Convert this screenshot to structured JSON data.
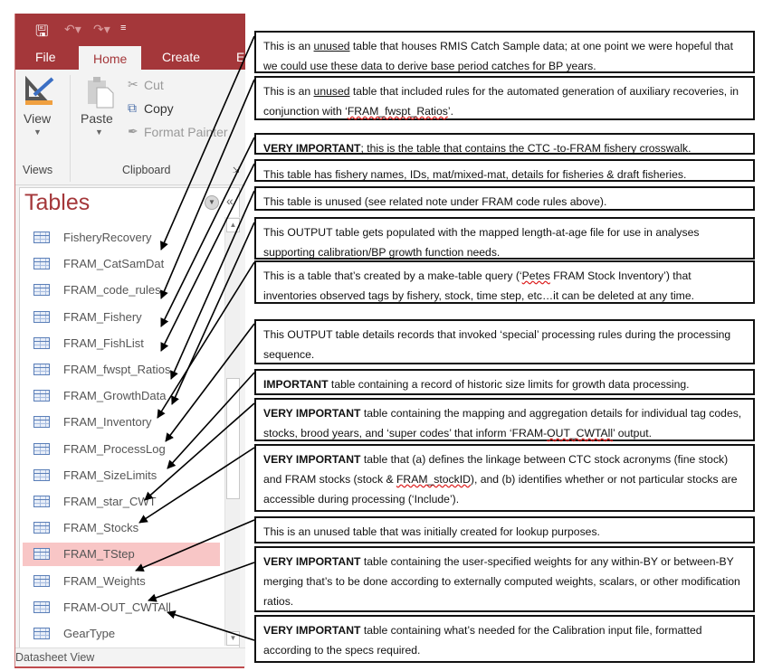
{
  "app": {
    "quick_access": {
      "save_icon": "save-icon",
      "undo_icon": "undo-icon",
      "redo_icon": "redo-icon",
      "customize_icon": "customize-qat-icon"
    },
    "tabs": [
      {
        "label": "File",
        "active": false
      },
      {
        "label": "Home",
        "active": true
      },
      {
        "label": "Create",
        "active": false
      },
      {
        "label": "E",
        "active": false
      }
    ],
    "ribbon": {
      "views_group": {
        "label": "Views",
        "view_button": "View"
      },
      "clipboard_group": {
        "label": "Clipboard",
        "paste_button": "Paste",
        "cut": "Cut",
        "copy": "Copy",
        "format_painter": "Format Painter"
      }
    },
    "nav_pane": {
      "title": "Tables",
      "items": [
        {
          "label": "FisheryRecovery",
          "selected": false
        },
        {
          "label": "FRAM_CatSamDat",
          "selected": false
        },
        {
          "label": "FRAM_code_rules",
          "selected": false
        },
        {
          "label": "FRAM_Fishery",
          "selected": false
        },
        {
          "label": "FRAM_FishList",
          "selected": false
        },
        {
          "label": "FRAM_fwspt_Ratios",
          "selected": false
        },
        {
          "label": "FRAM_GrowthData",
          "selected": false
        },
        {
          "label": "FRAM_Inventory",
          "selected": false
        },
        {
          "label": "FRAM_ProcessLog",
          "selected": false
        },
        {
          "label": "FRAM_SizeLimits",
          "selected": false
        },
        {
          "label": "FRAM_star_CWT",
          "selected": false
        },
        {
          "label": "FRAM_Stocks",
          "selected": false
        },
        {
          "label": "FRAM_TStep",
          "selected": true
        },
        {
          "label": "FRAM_Weights",
          "selected": false
        },
        {
          "label": "FRAM-OUT_CWTAll",
          "selected": false
        },
        {
          "label": "GearType",
          "selected": false
        }
      ],
      "selected_color": "#f8c6c6"
    },
    "status_bar": "Datasheet View",
    "accent_color": "#a4373a"
  },
  "notes": [
    {
      "target": "FRAM_CatSamDat",
      "parts": [
        {
          "t": "This is an "
        },
        {
          "t": "unused",
          "u": true
        },
        {
          "t": " table that houses RMIS Catch Sample data; at one point we were hopeful that we could use these data to derive base period catches for BP years."
        }
      ]
    },
    {
      "target": "FRAM_code_rules",
      "parts": [
        {
          "t": "This is an "
        },
        {
          "t": "unused",
          "u": true
        },
        {
          "t": " table that included rules for the automated generation of auxiliary recoveries, in conjunction with ‘"
        },
        {
          "t": "FRAM_fwspt_Ratios",
          "s": true
        },
        {
          "t": "’."
        }
      ]
    },
    {
      "target": "FRAM_Fishery",
      "parts": [
        {
          "t": "VERY IMPORTANT",
          "b": true
        },
        {
          "t": "; this is the table that contains the CTC -to-FRAM fishery crosswalk."
        }
      ]
    },
    {
      "target": "FRAM_FishList",
      "parts": [
        {
          "t": "This table has fishery names, IDs, mat/mixed-mat, details for fisheries & draft fisheries."
        }
      ]
    },
    {
      "target": "FRAM_fwspt_Ratios",
      "parts": [
        {
          "t": "This table is unused (see related note under FRAM code rules above)."
        }
      ]
    },
    {
      "target": "FRAM_GrowthData",
      "parts": [
        {
          "t": "This OUTPUT table gets populated with the mapped length-at-age file for use in analyses supporting calibration/BP growth function needs."
        }
      ]
    },
    {
      "target": "FRAM_Inventory",
      "parts": [
        {
          "t": "This is a table that’s created by a make-table query (‘"
        },
        {
          "t": "Petes",
          "s": true
        },
        {
          "t": " FRAM Stock Inventory’) that inventories observed tags by fishery, stock, time step, etc…it can be deleted at any time."
        }
      ]
    },
    {
      "target": "FRAM_ProcessLog",
      "parts": [
        {
          "t": "This OUTPUT table details records that invoked ‘special’ processing rules during the processing sequence."
        }
      ]
    },
    {
      "target": "FRAM_SizeLimits",
      "parts": [
        {
          "t": "IMPORTANT",
          "b": true
        },
        {
          "t": " table containing a record of historic size limits for growth data processing."
        }
      ]
    },
    {
      "target": "FRAM_star_CWT",
      "parts": [
        {
          "t": "VERY IMPORTANT",
          "b": true
        },
        {
          "t": " table containing the mapping and aggregation details for individual tag codes, stocks, brood years, and ‘super codes’ that inform ‘FRAM-"
        },
        {
          "t": "OUT_CWTAll",
          "s": true
        },
        {
          "t": "’ output."
        }
      ]
    },
    {
      "target": "FRAM_Stocks",
      "parts": [
        {
          "t": "VERY IMPORTANT",
          "b": true
        },
        {
          "t": " table that (a) defines the linkage between CTC stock acronyms (fine stock) and FRAM stocks (stock & "
        },
        {
          "t": "FRAM_stockID",
          "s": true
        },
        {
          "t": "), and (b) identifies whether or not particular stocks are accessible during processing (‘Include’)."
        }
      ]
    },
    {
      "target": "FRAM_TStep",
      "parts": [
        {
          "t": "This is an unused table that was initially created for lookup purposes."
        }
      ]
    },
    {
      "target": "FRAM_Weights",
      "parts": [
        {
          "t": "VERY IMPORTANT",
          "b": true
        },
        {
          "t": " table containing the user-specified weights for any within-BY or between-BY merging that’s to be done according to externally computed weights, scalars, or other modification ratios."
        }
      ]
    },
    {
      "target": "FRAM-OUT_CWTAll",
      "parts": [
        {
          "t": "VERY IMPORTANT",
          "b": true
        },
        {
          "t": " table containing what’s needed for the Calibration input file, formatted according to the specs required."
        }
      ]
    }
  ]
}
